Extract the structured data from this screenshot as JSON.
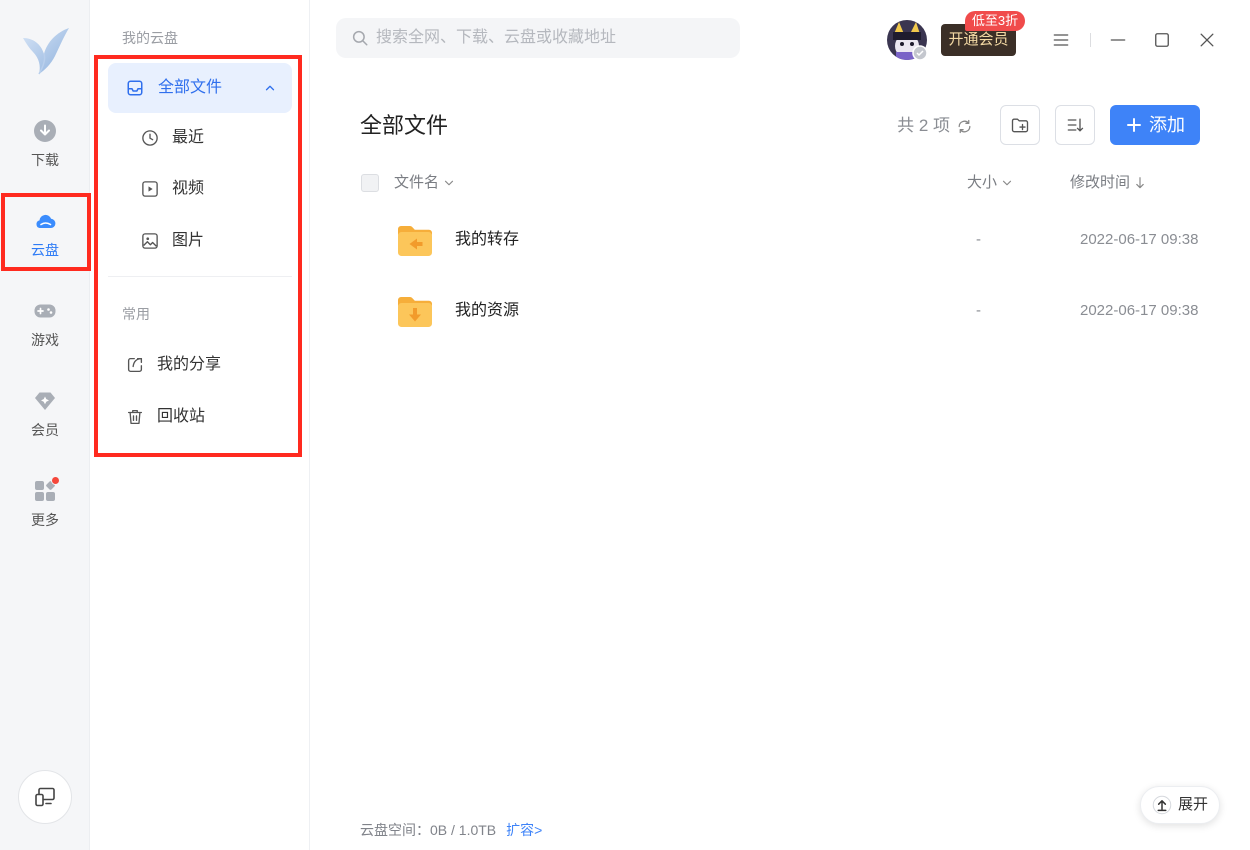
{
  "rail": {
    "logo_icon": "xunlei-bird-logo-icon",
    "items": [
      {
        "label": "下载",
        "icon": "download-icon"
      },
      {
        "label": "云盘",
        "icon": "cloud-icon"
      },
      {
        "label": "游戏",
        "icon": "gamepad-icon"
      },
      {
        "label": "会员",
        "icon": "diamond-icon"
      },
      {
        "label": "更多",
        "icon": "apps-icon"
      }
    ],
    "bottom_icon": "device-switch-icon"
  },
  "sidebar": {
    "section_title": "我的云盘",
    "all_files": {
      "label": "全部文件",
      "icon": "inbox-icon"
    },
    "items": [
      {
        "label": "最近",
        "icon": "clock-icon"
      },
      {
        "label": "视频",
        "icon": "video-icon"
      },
      {
        "label": "图片",
        "icon": "image-icon"
      }
    ],
    "common_title": "常用",
    "common_items": [
      {
        "label": "我的分享",
        "icon": "share-icon"
      },
      {
        "label": "回收站",
        "icon": "trash-icon"
      }
    ]
  },
  "topbar": {
    "search_placeholder": "搜索全网、下载、云盘或收藏地址",
    "vip_button": "开通会员",
    "vip_badge": "低至3折"
  },
  "main": {
    "title": "全部文件",
    "count": "共 2 项",
    "add_button": "添加",
    "columns": {
      "name": "文件名",
      "size": "大小",
      "modified": "修改时间"
    },
    "files": [
      {
        "name": "我的转存",
        "size": "-",
        "modified": "2022-06-17 09:38",
        "icon": "folder-transfer-icon"
      },
      {
        "name": "我的资源",
        "size": "-",
        "modified": "2022-06-17 09:38",
        "icon": "folder-download-icon"
      }
    ]
  },
  "footer": {
    "storage": "云盘空间：0B / 1.0TB",
    "expand_storage": "扩容>",
    "expand_button": "展开"
  },
  "colors": {
    "accent": "#3e83f8",
    "rail_bg": "#f5f6f8",
    "selected_bg": "#e8f0fe",
    "vip_bg": "#3b2f27",
    "vip_text": "#f3d9a4",
    "badge_red": "#f04b4b",
    "folder_orange": "#fcc65a",
    "highlight_red": "#ff2a1f"
  }
}
